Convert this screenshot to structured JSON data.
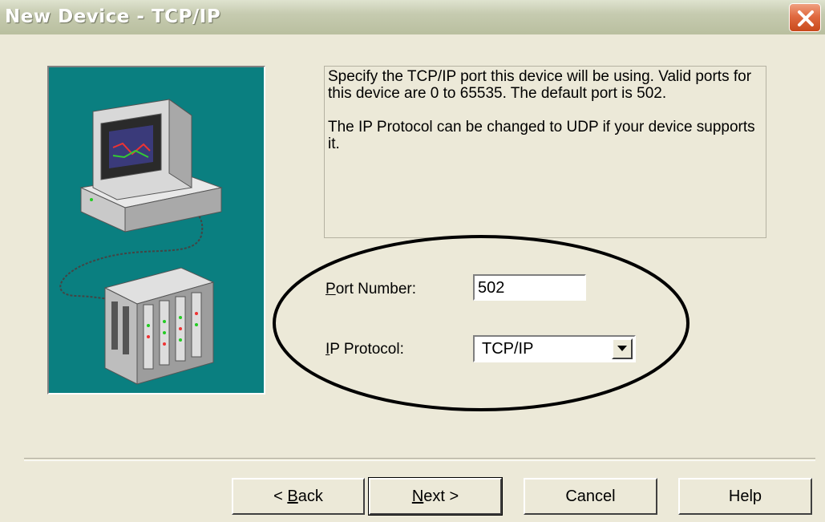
{
  "window": {
    "title": "New Device - TCP/IP"
  },
  "description": {
    "paragraph1": "Specify the TCP/IP port this device will be using.  Valid ports for this device are 0 to 65535. The default port is 502.",
    "paragraph2": "The IP Protocol can be changed to UDP if your device supports it."
  },
  "port": {
    "label_mnemonic": "P",
    "label_rest": "ort Number:",
    "value": "502"
  },
  "protocol": {
    "label_mnemonic": "I",
    "label_rest": "P Protocol:",
    "value": "TCP/IP"
  },
  "buttons": {
    "back_prefix": "< ",
    "back_mnemonic": "B",
    "back_rest": "ack",
    "next_mnemonic": "N",
    "next_rest": "ext >",
    "cancel": "Cancel",
    "help": "Help"
  },
  "icons": {
    "close": "close-icon",
    "dropdown": "chevron-down-icon",
    "illustration": "computer-device-illustration"
  },
  "colors": {
    "illustration_bg": "#0a7f80",
    "dialog_bg": "#ece9d8",
    "close_button": "#e06a40"
  }
}
